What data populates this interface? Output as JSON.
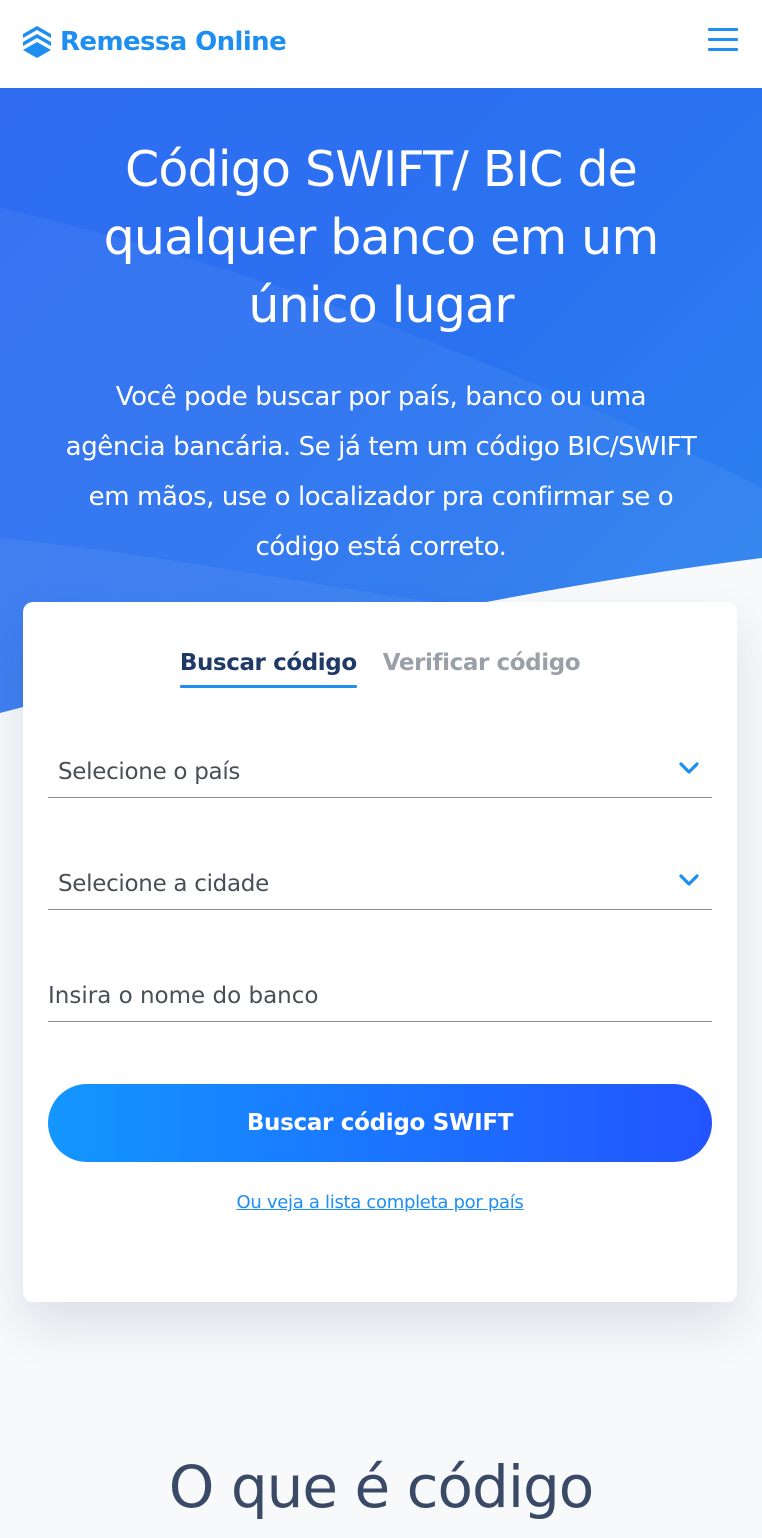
{
  "header": {
    "brand": "Remessa Online",
    "logo_icon": "remessa-logo-icon",
    "menu_icon": "hamburger-menu-icon"
  },
  "hero": {
    "title_line1": "Código SWIFT/ BIC de",
    "title_line2": "qualquer banco em um",
    "title_line3": "único lugar",
    "subtitle_line1": "Você pode buscar por país, banco ou uma",
    "subtitle_line2": "agência bancária. Se já tem um código BIC/SWIFT",
    "subtitle_line3": "em mãos, use o localizador pra confirmar se o",
    "subtitle_line4": "código está correto."
  },
  "search_card": {
    "tabs": [
      {
        "label": "Buscar código",
        "active": true
      },
      {
        "label": "Verificar código",
        "active": false
      }
    ],
    "country_select": {
      "placeholder": "Selecione o país"
    },
    "city_select": {
      "placeholder": "Selecione a cidade"
    },
    "bank_input": {
      "placeholder": "Insira o nome do banco",
      "value": ""
    },
    "submit_label": "Buscar código SWIFT",
    "list_link": "Ou veja a lista completa por país"
  },
  "section": {
    "title_partial": "O que é código"
  },
  "colors": {
    "brand_blue": "#1e8ff0",
    "hero_blue": "#2f6cf2",
    "dark_navy": "#1f3a66",
    "cta_start": "#1396ff",
    "cta_end": "#2354ff"
  }
}
